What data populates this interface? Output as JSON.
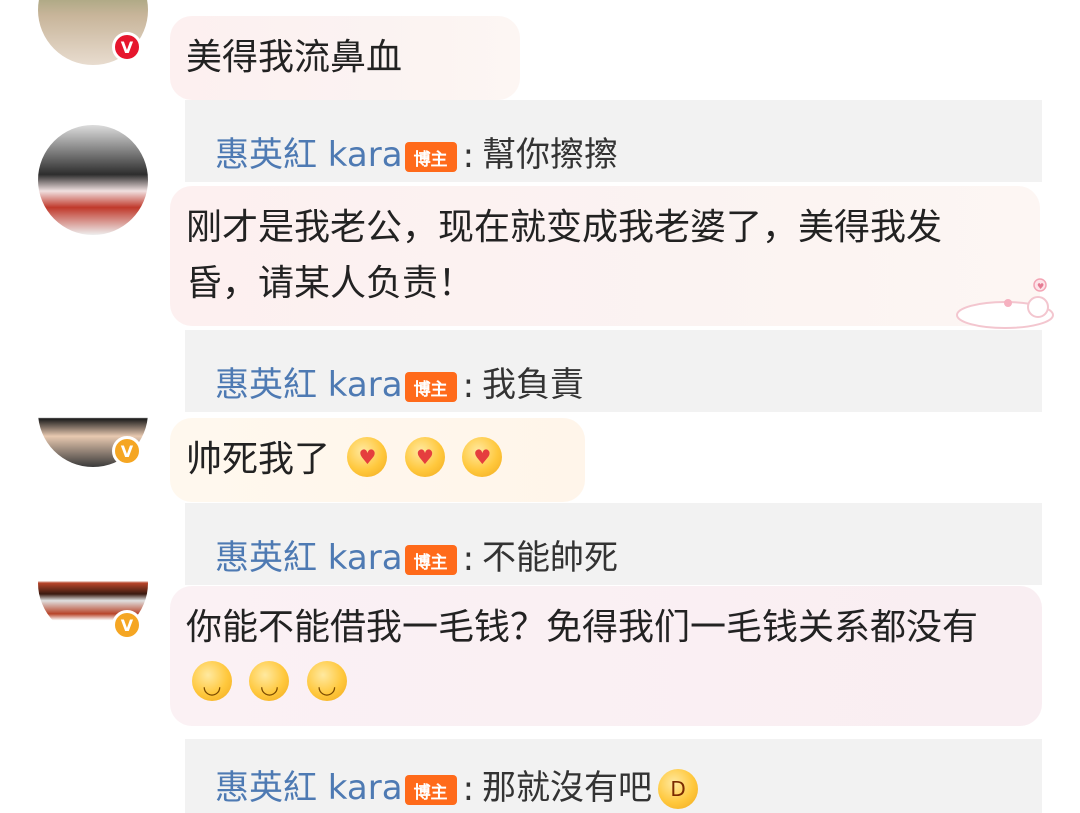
{
  "comments": [
    {
      "text": "美得我流鼻血",
      "badge": "V"
    },
    {
      "text": "刚才是我老公，现在就变成我老婆了，美得我发昏，请某人负责！"
    },
    {
      "text": "帅死我了",
      "badge": "V",
      "emojis": [
        "kiss-emoji",
        "kiss-emoji",
        "kiss-emoji"
      ]
    },
    {
      "text": "你能不能借我一毛钱？免得我们一毛钱关系都没有",
      "badge": "V",
      "emojis": [
        "grin-emoji",
        "grin-emoji",
        "grin-emoji"
      ]
    }
  ],
  "replies": [
    {
      "name": "惠英紅 kara",
      "tag": "博主",
      "sep": ":",
      "text": "幫你擦擦"
    },
    {
      "name": "惠英紅 kara",
      "tag": "博主",
      "sep": ":",
      "text": "我負責"
    },
    {
      "name": "惠英紅 kara",
      "tag": "博主",
      "sep": ":",
      "text": "不能帥死"
    },
    {
      "name": "惠英紅 kara",
      "tag": "博主",
      "sep": ":",
      "text": "那就沒有吧",
      "emojis": [
        "laugh-emoji"
      ]
    }
  ],
  "colors": {
    "name": "#4e7ab3",
    "tag": "#ff6a1a",
    "badge_red": "#e6162d",
    "badge_gold": "#f5a623"
  }
}
